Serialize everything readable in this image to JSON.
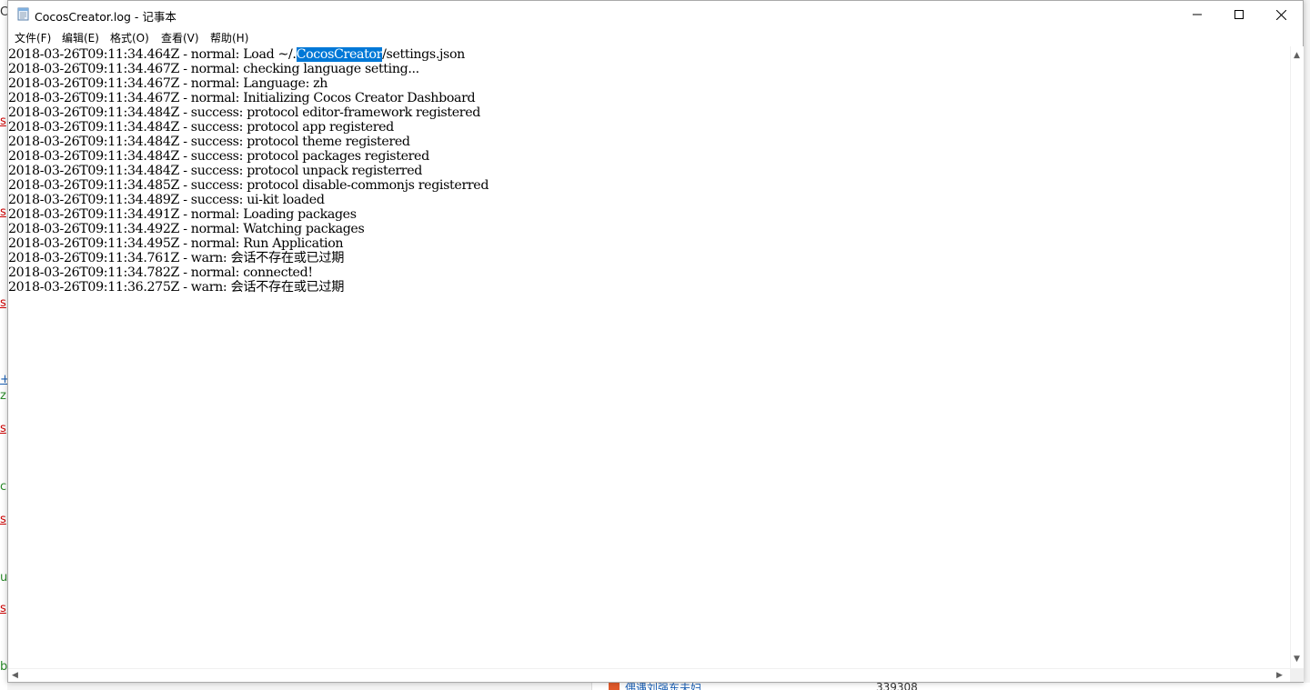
{
  "window": {
    "title": "CocosCreator.log - 记事本",
    "icon": "notepad-icon",
    "controls": {
      "minimize": "minimize-icon",
      "maximize": "maximize-icon",
      "close": "close-icon"
    }
  },
  "menu": {
    "file": "文件(F)",
    "edit": "编辑(E)",
    "format": "格式(O)",
    "view": "查看(V)",
    "help": "帮助(H)"
  },
  "editor": {
    "selected_text": "CocosCreator",
    "lines": [
      "2018-03-26T09:11:34.464Z - normal: Load ~/.CocosCreator/settings.json",
      "2018-03-26T09:11:34.467Z - normal: checking language setting...",
      "2018-03-26T09:11:34.467Z - normal: Language: zh",
      "2018-03-26T09:11:34.467Z - normal: Initializing Cocos Creator Dashboard",
      "2018-03-26T09:11:34.484Z - success: protocol editor-framework registered",
      "2018-03-26T09:11:34.484Z - success: protocol app registered",
      "2018-03-26T09:11:34.484Z - success: protocol theme registered",
      "2018-03-26T09:11:34.484Z - success: protocol packages registered",
      "2018-03-26T09:11:34.484Z - success: protocol unpack registerred",
      "2018-03-26T09:11:34.485Z - success: protocol disable-commonjs registerred",
      "2018-03-26T09:11:34.489Z - success: ui-kit loaded",
      "2018-03-26T09:11:34.491Z - normal: Loading packages",
      "2018-03-26T09:11:34.492Z - normal: Watching packages",
      "2018-03-26T09:11:34.495Z - normal: Run Application",
      "2018-03-26T09:11:34.761Z - warn: 会话不存在或已过期",
      "2018-03-26T09:11:34.782Z - normal: connected!",
      "2018-03-26T09:11:36.275Z - warn: 会话不存在或已过期"
    ]
  },
  "background": {
    "bottom_link": "偶遇刘强东夫妇",
    "bottom_number": "339308",
    "accent_color": "#1a5fb4",
    "badge_color": "#e05a2b"
  },
  "colors": {
    "selection": "#0078d7",
    "text": "#000000",
    "window_bg": "#ffffff"
  }
}
